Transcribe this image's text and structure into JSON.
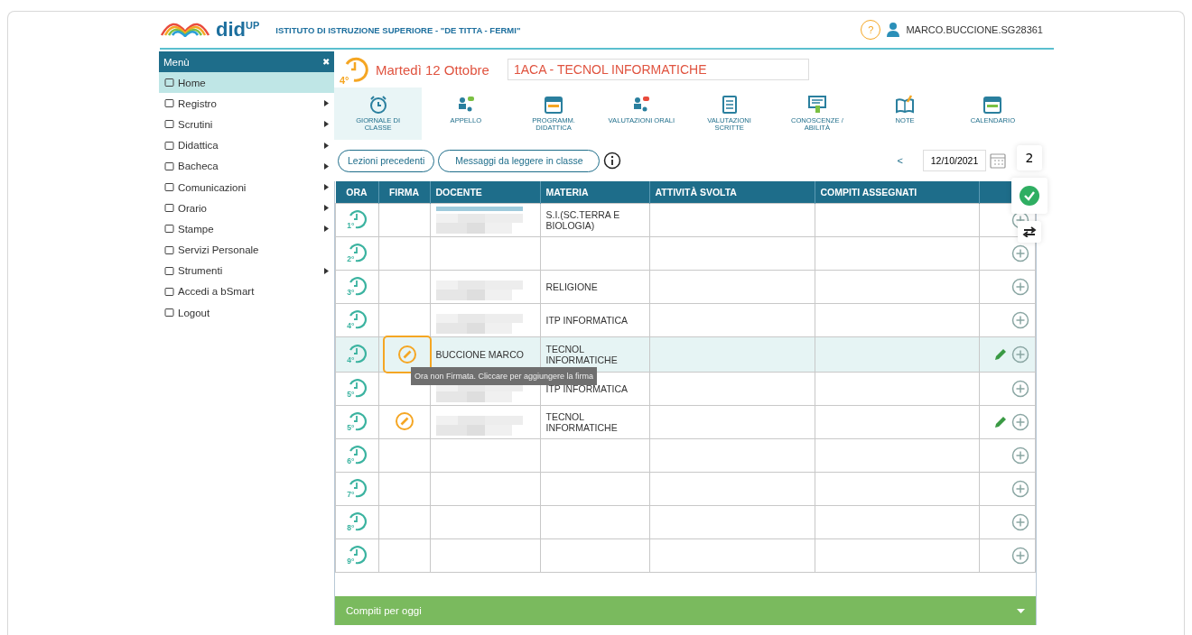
{
  "header": {
    "logo": "did$^{UP}$",
    "school": "ISTITUTO DI ISTRUZIONE SUPERIORE - \"DE TITTA - FERMI\"",
    "help": "?",
    "user": "MARCO.BUCCIONE.SG28361"
  },
  "sidebar": {
    "title": "Menù",
    "close": "✖",
    "items": [
      {
        "label": "Home",
        "selected": true,
        "submenu": false
      },
      {
        "label": "Registro",
        "selected": false,
        "submenu": true
      },
      {
        "label": "Scrutini",
        "selected": false,
        "submenu": true
      },
      {
        "label": "Didattica",
        "selected": false,
        "submenu": true
      },
      {
        "label": "Bacheca",
        "selected": false,
        "submenu": true
      },
      {
        "label": "Comunicazioni",
        "selected": false,
        "submenu": true
      },
      {
        "label": "Orario",
        "selected": false,
        "submenu": true
      },
      {
        "label": "Stampe",
        "selected": false,
        "submenu": true
      },
      {
        "label": "Servizi Personale",
        "selected": false,
        "submenu": false
      },
      {
        "label": "Strumenti",
        "selected": false,
        "submenu": true
      },
      {
        "label": "Accedi a bSmart",
        "selected": false,
        "submenu": false
      },
      {
        "label": "Logout",
        "selected": false,
        "submenu": false
      }
    ]
  },
  "lesson": {
    "hour": "4°",
    "date": "Martedì 12 Ottobre",
    "class": "1ACA - TECNOL INFORMATICHE"
  },
  "toolbar": [
    {
      "label": "GIORNALE DI CLASSE",
      "selected": true
    },
    {
      "label": "APPELLO",
      "selected": false
    },
    {
      "label": "PROGRAMM. DIDATTICA",
      "selected": false
    },
    {
      "label": "VALUTAZIONI ORALI",
      "selected": false
    },
    {
      "label": "VALUTAZIONI SCRITTE",
      "selected": false
    },
    {
      "label": "CONOSCENZE / ABILITÀ",
      "selected": false
    },
    {
      "label": "NOTE",
      "selected": false
    },
    {
      "label": "CALENDARIO",
      "selected": false
    }
  ],
  "actions": {
    "buttons": [
      "Lezioni precedenti",
      "Messaggi da leggere in classe"
    ],
    "prev": "<",
    "date": "12/10/2021"
  },
  "side_widgets": {
    "count": "2"
  },
  "table": {
    "columns": [
      "ORA",
      "FIRMA",
      "DOCENTE",
      "MATERIA",
      "ATTIVITÀ SVOLTA",
      "COMPITI ASSEGNATI"
    ],
    "rows": [
      {
        "ora": "1°",
        "signable": false,
        "redacted": true,
        "docente": "",
        "materia": "S.I.(SC.TERRA E BIOLOGIA)",
        "editable": false,
        "selected": false
      },
      {
        "ora": "2°",
        "signable": false,
        "redacted": false,
        "docente": "",
        "materia": "",
        "editable": false,
        "selected": false
      },
      {
        "ora": "3°",
        "signable": false,
        "redacted": true,
        "docente": "",
        "materia": "RELIGIONE",
        "editable": false,
        "selected": false
      },
      {
        "ora": "4°",
        "signable": false,
        "redacted": true,
        "docente": "",
        "materia": "ITP INFORMATICA",
        "editable": false,
        "selected": false
      },
      {
        "ora": "4°",
        "signable": true,
        "redacted": false,
        "docente": "BUCCIONE MARCO",
        "materia": "TECNOL INFORMATICHE",
        "editable": true,
        "selected": true
      },
      {
        "ora": "5°",
        "signable": false,
        "redacted": true,
        "docente": "",
        "materia": "ITP INFORMATICA",
        "editable": false,
        "selected": false
      },
      {
        "ora": "5°",
        "signable": true,
        "redacted": true,
        "docente": "",
        "materia": "TECNOL INFORMATICHE",
        "editable": true,
        "selected": false
      },
      {
        "ora": "6°",
        "signable": false,
        "redacted": false,
        "docente": "",
        "materia": "",
        "editable": false,
        "selected": false
      },
      {
        "ora": "7°",
        "signable": false,
        "redacted": false,
        "docente": "",
        "materia": "",
        "editable": false,
        "selected": false
      },
      {
        "ora": "8°",
        "signable": false,
        "redacted": false,
        "docente": "",
        "materia": "",
        "editable": false,
        "selected": false
      },
      {
        "ora": "9°",
        "signable": false,
        "redacted": false,
        "docente": "",
        "materia": "",
        "editable": false,
        "selected": false
      }
    ]
  },
  "tooltip": "Ora non Firmata. Cliccare per aggiungere la firma",
  "footer_panel": {
    "title": "Compiti per oggi",
    "expanded": false
  }
}
